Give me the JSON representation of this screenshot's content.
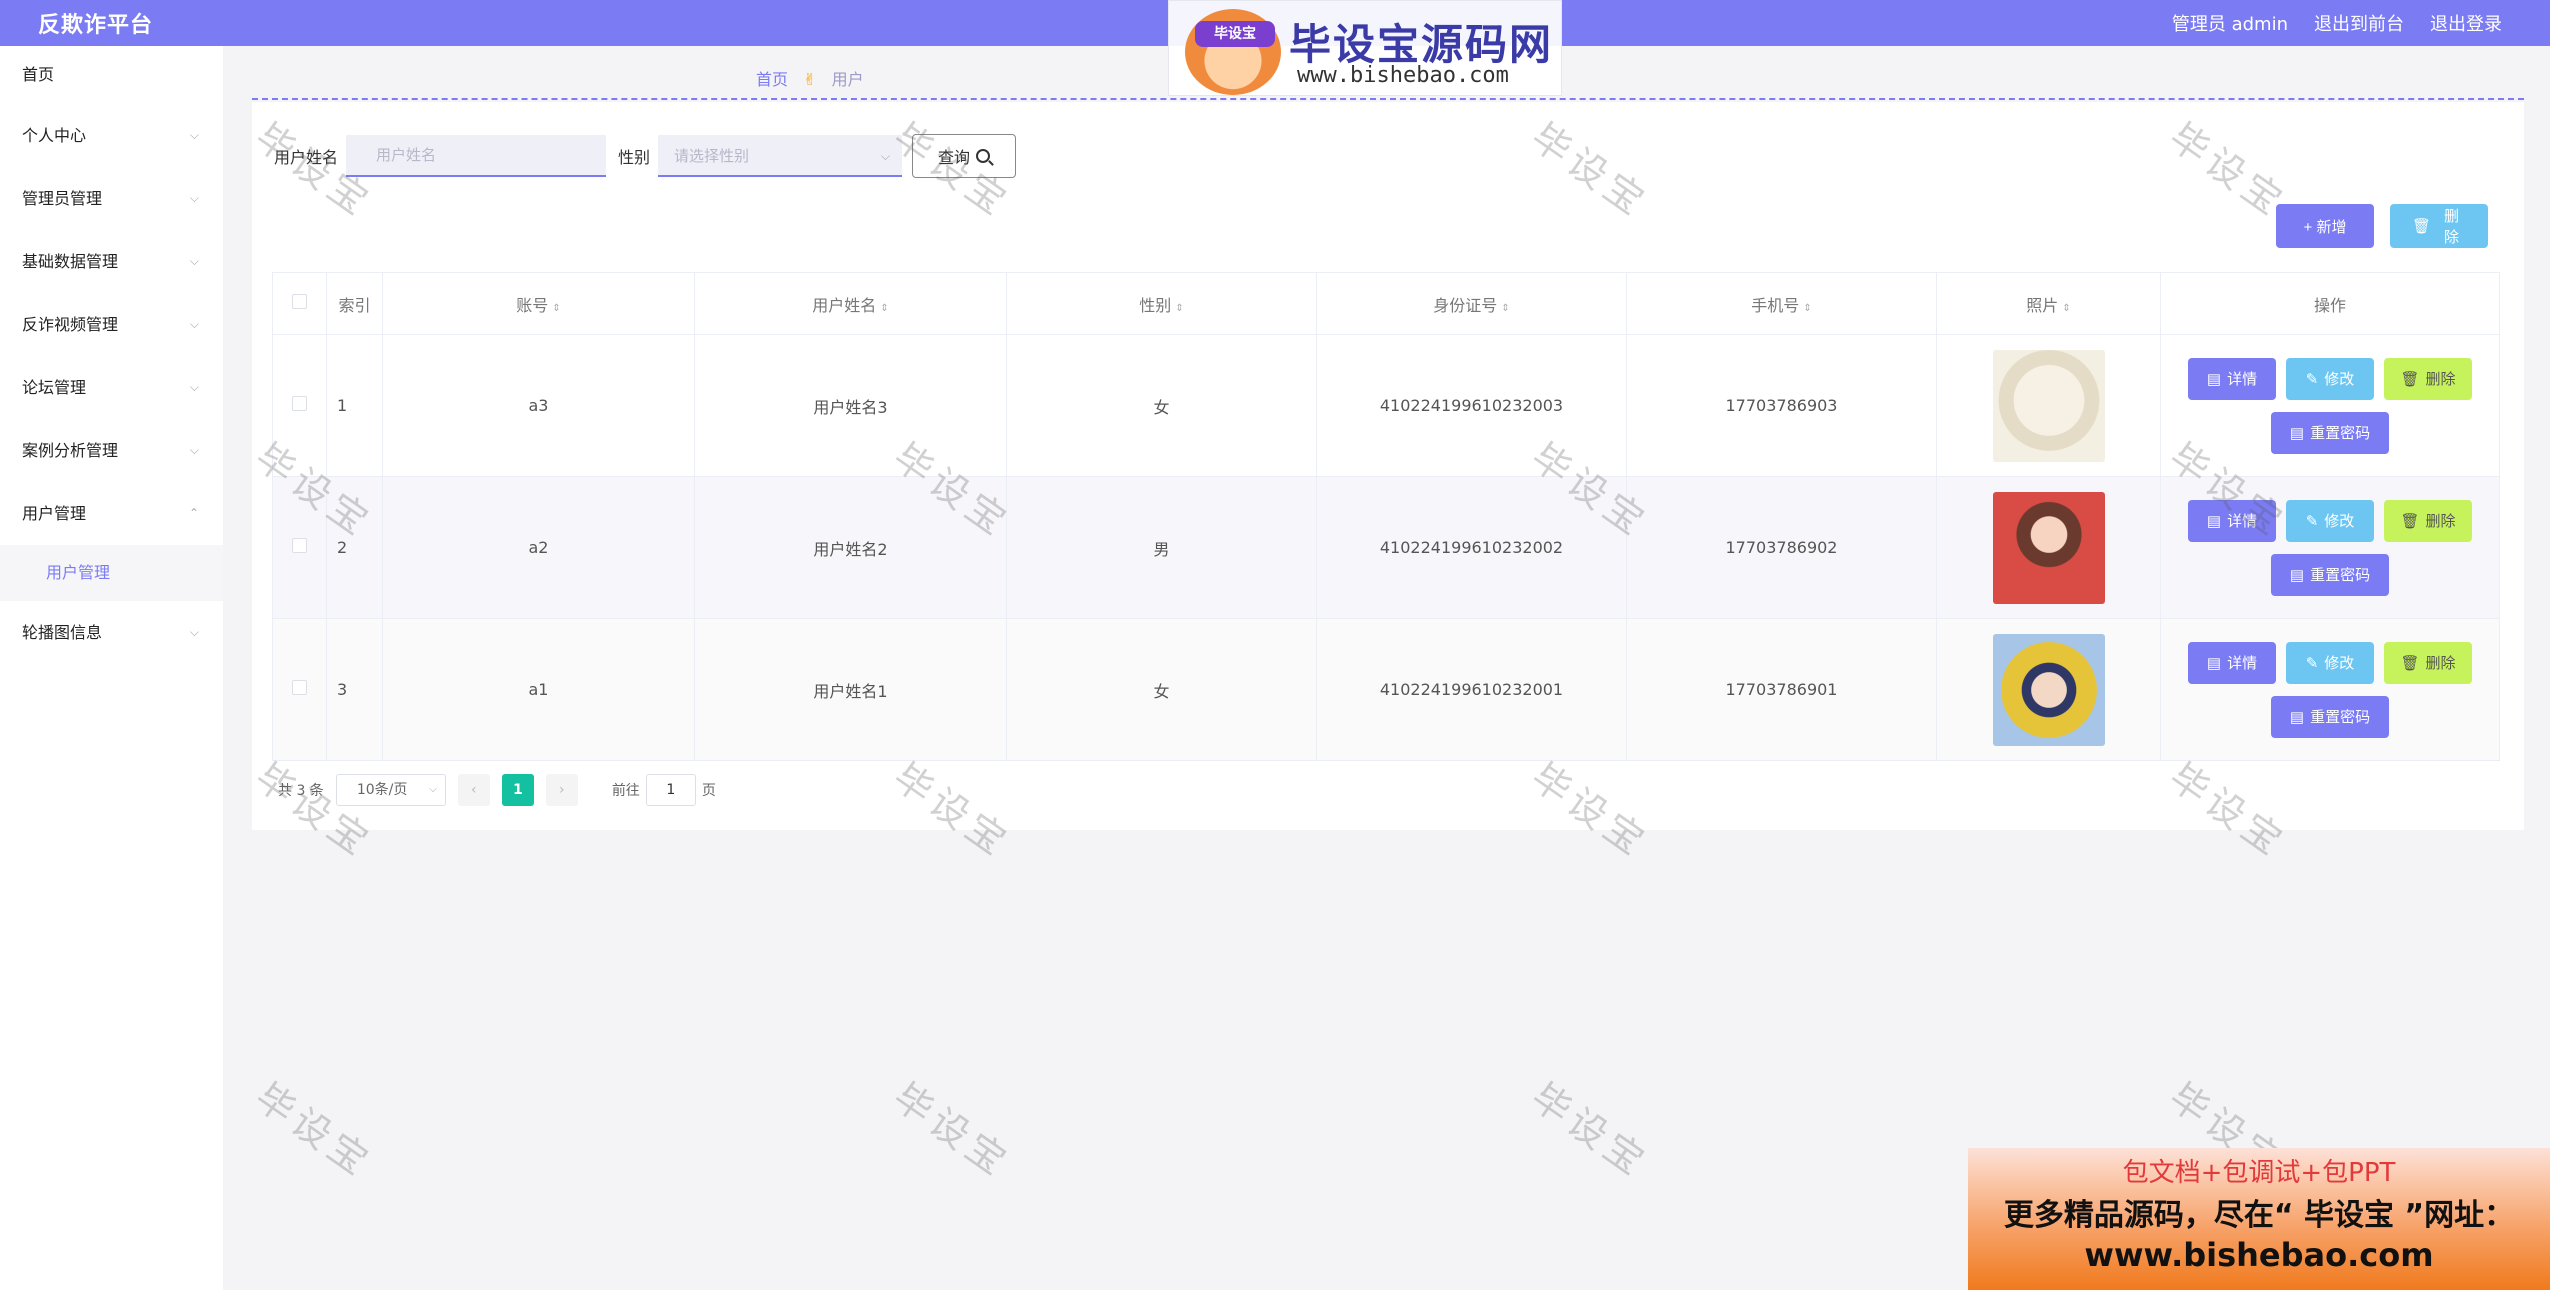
{
  "header": {
    "brand": "反欺诈平台",
    "admin": "管理员 admin",
    "front": "退出到前台",
    "logout": "退出登录"
  },
  "watermark_logo": {
    "badge": "毕设宝",
    "title": "毕设宝源码网",
    "url": "www.bishebao.com"
  },
  "sidebar": {
    "items": [
      {
        "label": "首页"
      },
      {
        "label": "个人中心"
      },
      {
        "label": "管理员管理"
      },
      {
        "label": "基础数据管理"
      },
      {
        "label": "反诈视频管理"
      },
      {
        "label": "论坛管理"
      },
      {
        "label": "案例分析管理"
      },
      {
        "label": "用户管理"
      },
      {
        "label": "轮播图信息"
      }
    ],
    "sub_active": "用户管理"
  },
  "breadcrumb": {
    "home": "首页",
    "current": "用户"
  },
  "search": {
    "name_label": "用户姓名",
    "name_placeholder": "用户姓名",
    "gender_label": "性别",
    "gender_placeholder": "请选择性别",
    "query_label": "查询"
  },
  "toolbar": {
    "add_label": "+ 新增",
    "delete_label": "删除"
  },
  "table": {
    "headers": [
      "索引",
      "账号",
      "用户姓名",
      "性别",
      "身份证号",
      "手机号",
      "照片",
      "操作"
    ],
    "rows": [
      {
        "index": "1",
        "account": "a3",
        "name": "用户姓名3",
        "gender": "女",
        "id_no": "410224199610232003",
        "phone": "17703786903",
        "photo": "bear"
      },
      {
        "index": "2",
        "account": "a2",
        "name": "用户姓名2",
        "gender": "男",
        "id_no": "410224199610232002",
        "phone": "17703786902",
        "photo": "girl"
      },
      {
        "index": "3",
        "account": "a1",
        "name": "用户姓名1",
        "gender": "女",
        "id_no": "410224199610232001",
        "phone": "17703786901",
        "photo": "boy"
      }
    ],
    "row_actions": {
      "detail": "详情",
      "edit": "修改",
      "delete": "删除",
      "reset": "重置密码"
    }
  },
  "pagination": {
    "total": "共 3 条",
    "page_size": "10条/页",
    "current_page": "1",
    "goto_label": "前往",
    "goto_value": "1",
    "page_unit": "页"
  },
  "watermark_text": "毕设宝",
  "ad": {
    "line1": "包文档+包调试+包PPT",
    "line2": "更多精品源码，尽在“ 毕设宝 ”网址：",
    "line3": "www.bishebao.com"
  },
  "colors": {
    "primary": "#7b7bf3",
    "info": "#6dc6f2",
    "warning": "#c6f35b",
    "page_active": "#13c0a0"
  }
}
